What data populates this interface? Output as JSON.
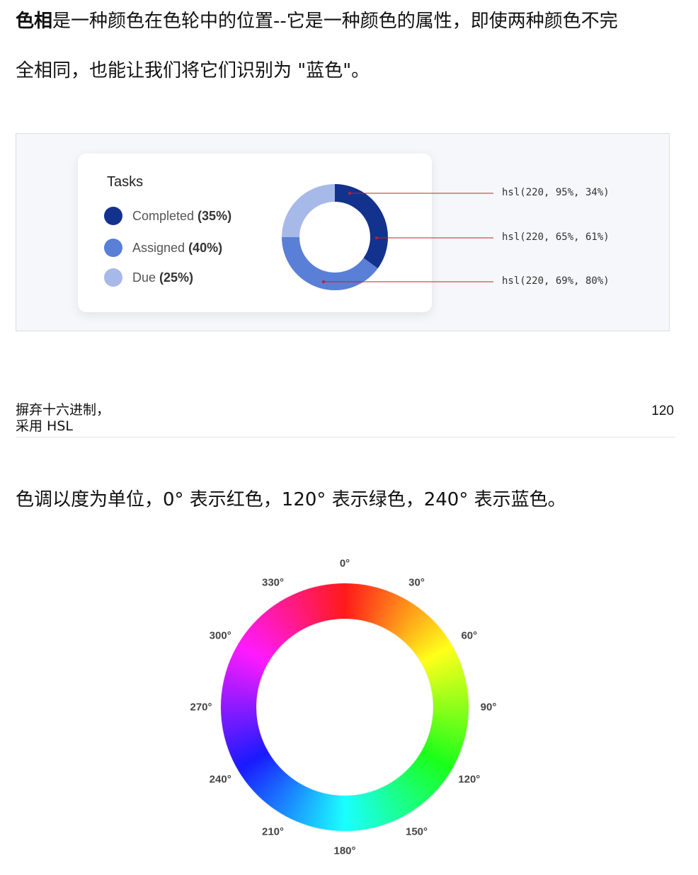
{
  "intro": {
    "term": "色相",
    "line1_rest": "是一种颜色在色轮中的位置--它是一种颜色的属性，即使两种颜色不完",
    "line2": "全相同，也能让我们将它们识别为 \"蓝色\"。"
  },
  "tasks_card": {
    "title": "Tasks",
    "legend": [
      {
        "label": "Completed",
        "pct": "(35%)",
        "color": "#13328e",
        "value": 35
      },
      {
        "label": "Assigned",
        "pct": "(40%)",
        "color": "#5a7fd6",
        "value": 40
      },
      {
        "label": "Due",
        "pct": "(25%)",
        "color": "#a7b9e8",
        "value": 25
      }
    ],
    "hsl_labels": [
      "hsl(220, 95%, 34%)",
      "hsl(220, 65%, 61%)",
      "hsl(220, 69%, 80%)"
    ],
    "annotation_color": "#c0202a"
  },
  "footer": {
    "left_line1": "摒弃十六进制，",
    "left_line2": "采用 HSL",
    "page_number": "120"
  },
  "hue_text": "色调以度为单位，0° 表示红色，120° 表示绿色，240° 表示蓝色。",
  "hue_wheel": {
    "labels": [
      "0°",
      "30°",
      "60°",
      "90°",
      "120°",
      "150°",
      "180°",
      "210°",
      "240°",
      "270°",
      "300°",
      "330°"
    ],
    "angles": [
      0,
      30,
      60,
      90,
      120,
      150,
      180,
      210,
      240,
      270,
      300,
      330
    ]
  }
}
